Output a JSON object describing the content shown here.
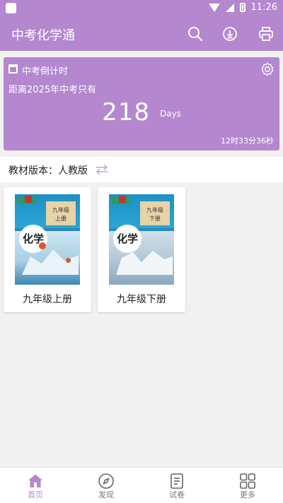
{
  "status_bar": {
    "time": "11:26"
  },
  "app_bar": {
    "title": "中考化学通"
  },
  "countdown": {
    "label": "中考倒计时",
    "subtitle": "距离2025年中考只有",
    "days": "218",
    "unit": "Days",
    "time_left": "12时33分36秒"
  },
  "edition": {
    "label": "教材版本：人教版"
  },
  "books": [
    {
      "title": "九年级上册",
      "grade": "九年级",
      "volume": "上册",
      "chem": "化学"
    },
    {
      "title": "九年级下册",
      "grade": "九年级",
      "volume": "下册",
      "chem": "化学"
    }
  ],
  "bottom_nav": [
    {
      "label": "首页",
      "icon": "home-icon",
      "active": true
    },
    {
      "label": "发现",
      "icon": "compass-icon"
    },
    {
      "label": "试卷",
      "icon": "document-icon"
    },
    {
      "label": "更多",
      "icon": "grid-icon"
    }
  ],
  "colors": {
    "accent": "#b487cf",
    "background": "#f1f1f1"
  }
}
